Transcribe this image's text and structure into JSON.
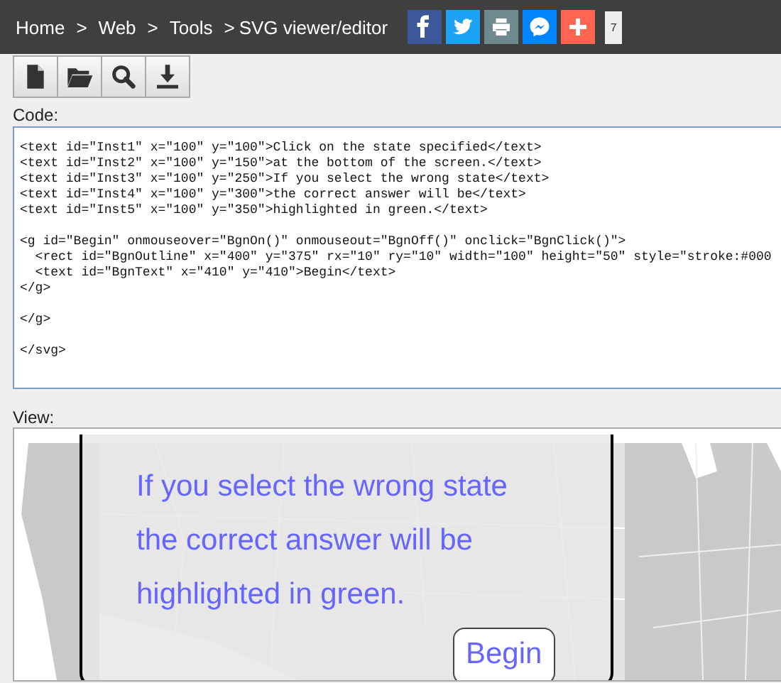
{
  "breadcrumbs": [
    {
      "kind": "link",
      "text": "Home"
    },
    {
      "kind": "separator",
      "text": ">"
    },
    {
      "kind": "link",
      "text": "Web"
    },
    {
      "kind": "separator",
      "text": ">"
    },
    {
      "kind": "link",
      "text": "Tools"
    },
    {
      "kind": "separator",
      "text": ">"
    },
    {
      "kind": "current",
      "text": "SVG viewer/editor"
    }
  ],
  "share_buttons": [
    {
      "kind": "facebook"
    },
    {
      "kind": "twitter"
    },
    {
      "kind": "print"
    },
    {
      "kind": "messenger"
    },
    {
      "kind": "more"
    }
  ],
  "share_count": "7",
  "toolbar": [
    {
      "kind": "new"
    },
    {
      "kind": "open"
    },
    {
      "kind": "search"
    },
    {
      "kind": "download"
    }
  ],
  "code": {
    "label": "Code:",
    "value": "<text id=\"Inst1\" x=\"100\" y=\"100\">Click on the state specified</text>\n<text id=\"Inst2\" x=\"100\" y=\"150\">at the bottom of the screen.</text>\n<text id=\"Inst3\" x=\"100\" y=\"250\">If you select the wrong state</text>\n<text id=\"Inst4\" x=\"100\" y=\"300\">the correct answer will be</text>\n<text id=\"Inst5\" x=\"100\" y=\"350\">highlighted in green.</text>\n\n<g id=\"Begin\" onmouseover=\"BgnOn()\" onmouseout=\"BgnOff()\" onclick=\"BgnClick()\">\n  <rect id=\"BgnOutline\" x=\"400\" y=\"375\" rx=\"10\" ry=\"10\" width=\"100\" height=\"50\" style=\"stroke:#000\n  <text id=\"BgnText\" x=\"410\" y=\"410\">Begin</text>\n</g>\n\n</g>\n\n</svg>\n"
  },
  "view": {
    "label": "View:",
    "lines": [
      "If you select the wrong state",
      "the correct answer will be",
      "highlighted in green."
    ],
    "button": "Begin"
  }
}
